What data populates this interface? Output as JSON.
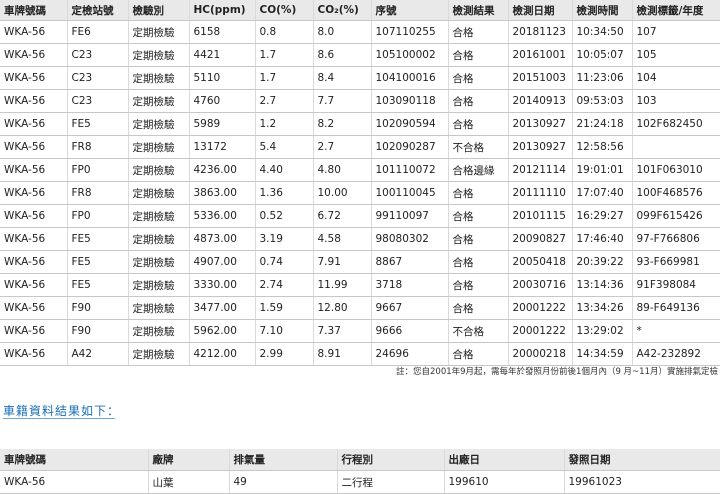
{
  "results": {
    "headers": [
      "車牌號碼",
      "定檢站號",
      "檢驗別",
      "HC(ppm)",
      "CO(%)",
      "CO₂(%)",
      "序號",
      "檢測結果",
      "檢測日期",
      "檢測時間",
      "檢測標籤/年度"
    ],
    "rows": [
      [
        "WKA-56",
        "FE6",
        "定期檢驗",
        "6158",
        "0.8",
        "8.0",
        "107110255",
        "合格",
        "20181123",
        "10:34:50",
        "107"
      ],
      [
        "WKA-56",
        "C23",
        "定期檢驗",
        "4421",
        "1.7",
        "8.6",
        "105100002",
        "合格",
        "20161001",
        "10:05:07",
        "105"
      ],
      [
        "WKA-56",
        "C23",
        "定期檢驗",
        "5110",
        "1.7",
        "8.4",
        "104100016",
        "合格",
        "20151003",
        "11:23:06",
        "104"
      ],
      [
        "WKA-56",
        "C23",
        "定期檢驗",
        "4760",
        "2.7",
        "7.7",
        "103090118",
        "合格",
        "20140913",
        "09:53:03",
        "103"
      ],
      [
        "WKA-56",
        "FE5",
        "定期檢驗",
        "5989",
        "1.2",
        "8.2",
        "102090594",
        "合格",
        "20130927",
        "21:24:18",
        "102F682450"
      ],
      [
        "WKA-56",
        "FR8",
        "定期檢驗",
        "13172",
        "5.4",
        "2.7",
        "102090287",
        "不合格",
        "20130927",
        "12:58:56",
        ""
      ],
      [
        "WKA-56",
        "FP0",
        "定期檢驗",
        "4236.00",
        "4.40",
        "4.80",
        "101110072",
        "合格邊緣",
        "20121114",
        "19:01:01",
        "101F063010"
      ],
      [
        "WKA-56",
        "FR8",
        "定期檢驗",
        "3863.00",
        "1.36",
        "10.00",
        "100110045",
        "合格",
        "20111110",
        "17:07:40",
        "100F468576"
      ],
      [
        "WKA-56",
        "FP0",
        "定期檢驗",
        "5336.00",
        "0.52",
        "6.72",
        "99110097",
        "合格",
        "20101115",
        "16:29:27",
        "099F615426"
      ],
      [
        "WKA-56",
        "FE5",
        "定期檢驗",
        "4873.00",
        "3.19",
        "4.58",
        "98080302",
        "合格",
        "20090827",
        "17:46:40",
        "97-F766806"
      ],
      [
        "WKA-56",
        "FE5",
        "定期檢驗",
        "4907.00",
        "0.74",
        "7.91",
        "8867",
        "合格",
        "20050418",
        "20:39:22",
        "93-F669981"
      ],
      [
        "WKA-56",
        "FE5",
        "定期檢驗",
        "3330.00",
        "2.74",
        "11.99",
        "3718",
        "合格",
        "20030716",
        "13:14:36",
        "91F398084"
      ],
      [
        "WKA-56",
        "F90",
        "定期檢驗",
        "3477.00",
        "1.59",
        "12.80",
        "9667",
        "合格",
        "20001222",
        "13:34:26",
        "89-F649136"
      ],
      [
        "WKA-56",
        "F90",
        "定期檢驗",
        "5962.00",
        "7.10",
        "7.37",
        "9666",
        "不合格",
        "20001222",
        "13:29:02",
        "*"
      ],
      [
        "WKA-56",
        "A42",
        "定期檢驗",
        "4212.00",
        "2.99",
        "8.91",
        "24696",
        "合格",
        "20000218",
        "14:34:59",
        "A42-232892"
      ]
    ]
  },
  "note": "註：您自2001年9月起，需每年於發照月份前後1個月內（9 月~11月）實施排氣定檢",
  "section_title": "車籍資料結果如下：",
  "car": {
    "headers": [
      "車牌號碼",
      "廠牌",
      "排氣量",
      "行程別",
      "出廠日",
      "發照日期"
    ],
    "row": [
      "WKA-56",
      "山葉",
      "49",
      "二行程",
      "199610",
      "19961023"
    ]
  }
}
